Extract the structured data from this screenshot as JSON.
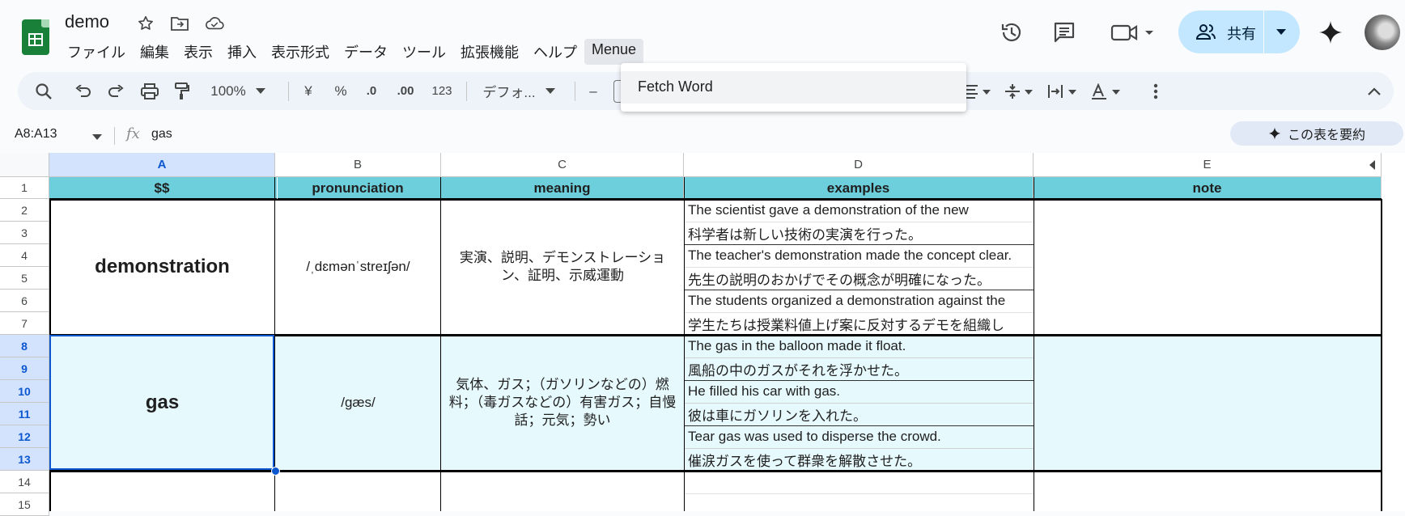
{
  "doc": {
    "title": "demo"
  },
  "menu": [
    "ファイル",
    "編集",
    "表示",
    "挿入",
    "表示形式",
    "データ",
    "ツール",
    "拡張機能",
    "ヘルプ",
    "Menue"
  ],
  "share": {
    "label": "共有"
  },
  "toolbar": {
    "zoom": "100%",
    "currency": "¥",
    "percent": "%",
    "dec_decrease": ".0",
    "dec_increase": ".00",
    "format_123": "123",
    "font": "デフォ...",
    "minus": "–"
  },
  "dropdown": {
    "item": "Fetch Word"
  },
  "formula_bar": {
    "name_box": "A8:A13",
    "fx": "fx",
    "value": "gas",
    "summarize": "この表を要約"
  },
  "columns": [
    "A",
    "B",
    "C",
    "D",
    "E"
  ],
  "rows": [
    "1",
    "2",
    "3",
    "4",
    "5",
    "6",
    "7",
    "8",
    "9",
    "10",
    "11",
    "12",
    "13",
    "14",
    "15"
  ],
  "header": {
    "a": "$$",
    "b": "pronunciation",
    "c": "meaning",
    "d": "examples",
    "e": "note"
  },
  "entries": [
    {
      "word": "demonstration",
      "pronunciation": "/ˌdɛmənˈstreɪʃən/",
      "meaning": "実演、説明、デモンストレーション、証明、示威運動",
      "examples": [
        "The scientist gave a demonstration of the new",
        "科学者は新しい技術の実演を行った。",
        "The teacher's demonstration made the concept clear.",
        "先生の説明のおかげでその概念が明確になった。",
        "The students organized a demonstration against the",
        "学生たちは授業料値上げ案に反対するデモを組織し"
      ]
    },
    {
      "word": "gas",
      "pronunciation": "/gæs/",
      "meaning": "気体、ガス；（ガソリンなどの）燃料；（毒ガスなどの）有害ガス；自慢話；元気；勢い",
      "examples": [
        "The gas in the balloon made it float.",
        "風船の中のガスがそれを浮かせた。",
        "He filled his car with gas.",
        "彼は車にガソリンを入れた。",
        "Tear gas was used to disperse the crowd.",
        "催涙ガスを使って群衆を解散させた。"
      ]
    }
  ],
  "colors": {
    "header_fill": "#6dcfdc",
    "selection_fill": "#e6f9fd",
    "selection_border": "#0b57d0",
    "share_bg": "#c2e7ff"
  }
}
